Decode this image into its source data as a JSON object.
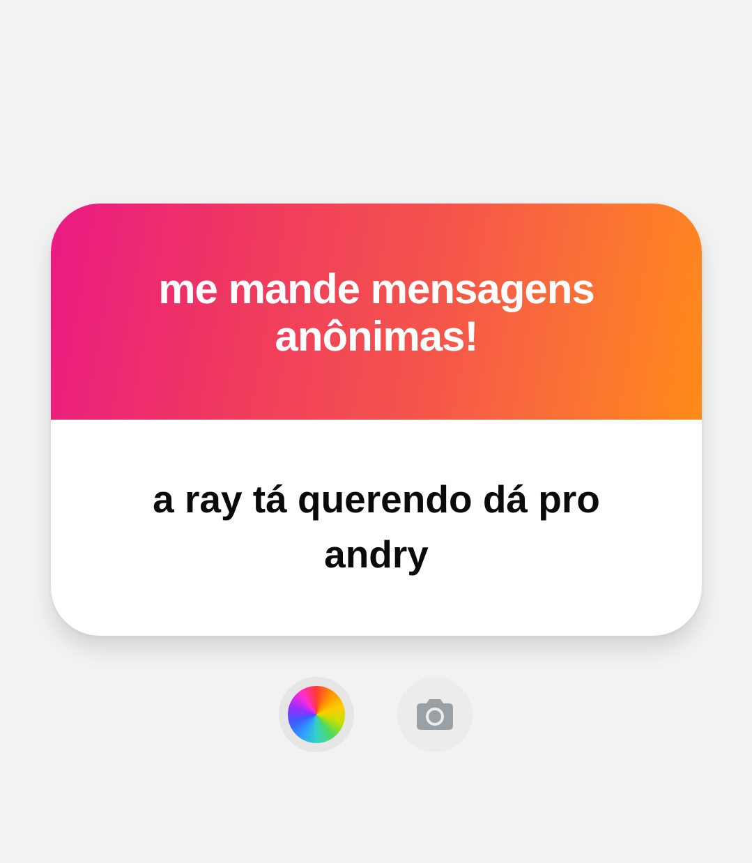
{
  "card": {
    "title": "me mande mensagens anônimas!",
    "response": "a ray tá querendo dá pro andry"
  },
  "controls": {
    "color_icon": "color-wheel-icon",
    "camera_icon": "camera-icon"
  },
  "colors": {
    "background": "#f2f2f2",
    "gradient_start": "#ea1a83",
    "gradient_end": "#ff8a18",
    "camera_icon": "#9aa0a6"
  }
}
